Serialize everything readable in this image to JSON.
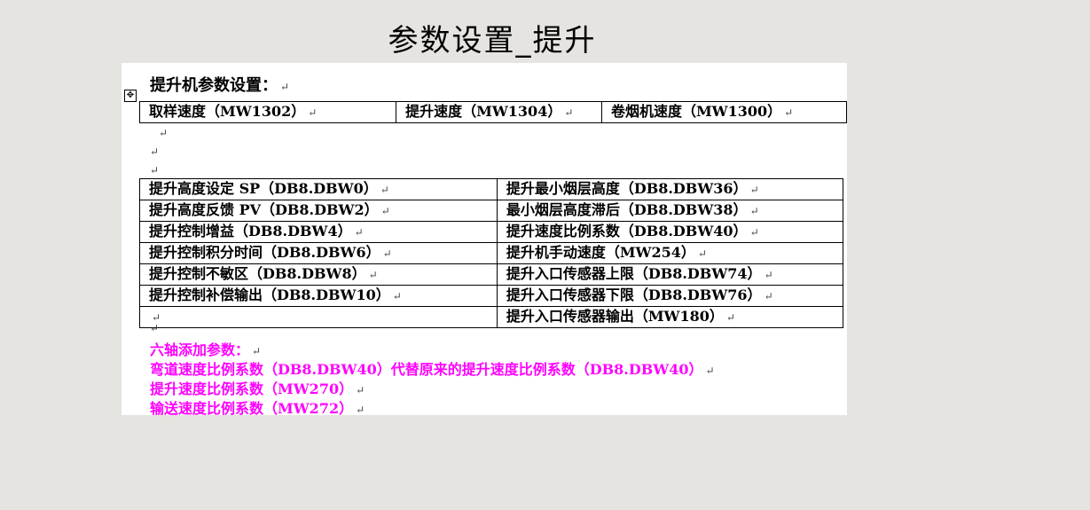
{
  "title": "参数设置_提升",
  "pilcrow": "↵",
  "doc": {
    "heading": "提升机参数设置：",
    "top_table": [
      "取样速度（MW1302）",
      "提升速度（MW1304）",
      "卷烟机速度（MW1300）"
    ],
    "main_table": {
      "rows": [
        [
          "提升高度设定 SP（DB8.DBW0）",
          "提升最小烟层高度（DB8.DBW36）"
        ],
        [
          "提升高度反馈 PV（DB8.DBW2）",
          "最小烟层高度滞后（DB8.DBW38）"
        ],
        [
          "提升控制增益（DB8.DBW4）",
          "提升速度比例系数（DB8.DBW40）"
        ],
        [
          "提升控制积分时间（DB8.DBW6）",
          "提升机手动速度（MW254）"
        ],
        [
          "提升控制不敏区（DB8.DBW8）",
          "提升入口传感器上限（DB8.DBW74）"
        ],
        [
          "提升控制补偿输出（DB8.DBW10）",
          "提升入口传感器下限（DB8.DBW76）"
        ],
        [
          "",
          "提升入口传感器输出（MW180）"
        ]
      ]
    },
    "additions": [
      "六轴添加参数：",
      "弯道速度比例系数（DB8.DBW40）代替原来的提升速度比例系数（DB8.DBW40）",
      "提升速度比例系数（MW270）",
      "输送速度比例系数（MW272）"
    ],
    "colors": {
      "addition_text": "#ff00ff",
      "background": "#e6e4e0"
    }
  }
}
